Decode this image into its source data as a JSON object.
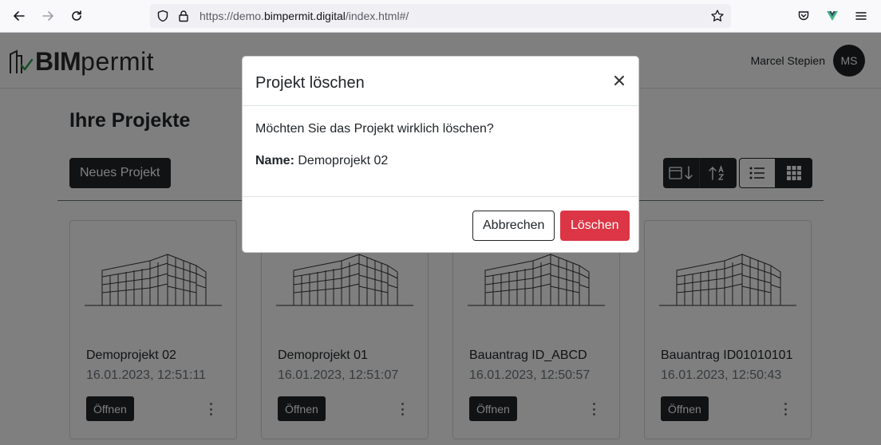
{
  "browser": {
    "url_prefix": "https://demo.",
    "url_domain": "bimpermit.digital",
    "url_suffix": "/index.html#/"
  },
  "header": {
    "logo_bold": "BIM",
    "logo_light": "permit",
    "user_name": "Marcel Stepien",
    "avatar_initials": "MS"
  },
  "main": {
    "title": "Ihre Projekte",
    "new_project_label": "Neues Projekt",
    "open_label": "Öffnen",
    "projects": [
      {
        "name": "Demoprojekt 02",
        "date": "16.01.2023, 12:51:11"
      },
      {
        "name": "Demoprojekt 01",
        "date": "16.01.2023, 12:51:07"
      },
      {
        "name": "Bauantrag ID_ABCD",
        "date": "16.01.2023, 12:50:57"
      },
      {
        "name": "Bauantrag ID01010101",
        "date": "16.01.2023, 12:50:43"
      }
    ]
  },
  "modal": {
    "title": "Projekt löschen",
    "question": "Möchten Sie das Projekt wirklich löschen?",
    "name_label": "Name:",
    "name_value": "Demoprojekt 02",
    "cancel_label": "Abbrechen",
    "delete_label": "Löschen"
  },
  "colors": {
    "dark": "#212529",
    "danger": "#dc3545",
    "logo_check": "#2e9b4f"
  }
}
